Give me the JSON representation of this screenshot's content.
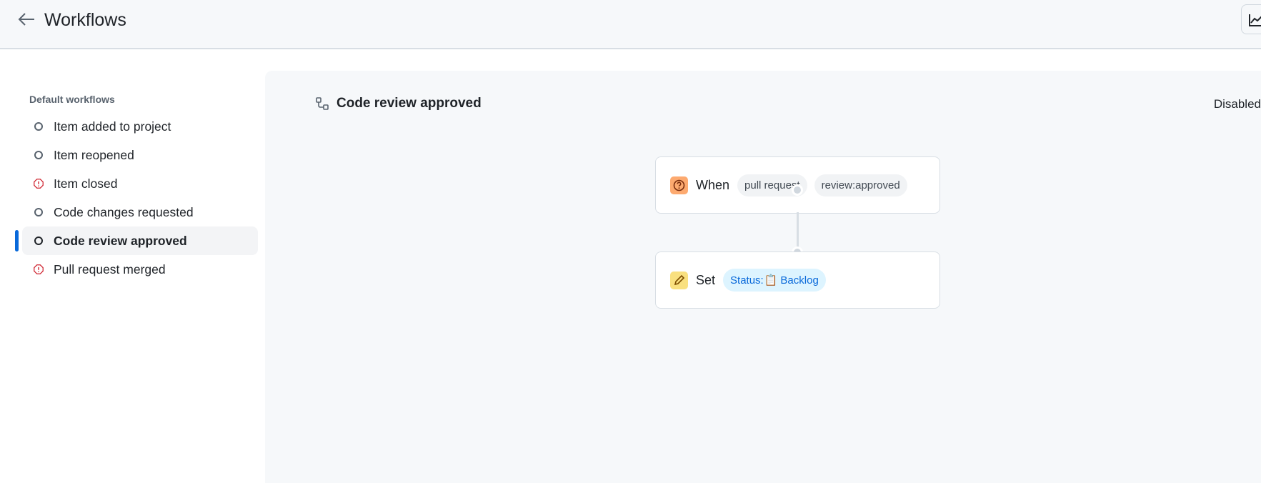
{
  "header": {
    "title": "Workflows",
    "back_icon": "arrow-left-icon",
    "insights_icon": "graph-icon"
  },
  "sidebar": {
    "heading": "Default workflows",
    "items": [
      {
        "label": "Item added to project",
        "status": "circle"
      },
      {
        "label": "Item reopened",
        "status": "circle"
      },
      {
        "label": "Item closed",
        "status": "alert"
      },
      {
        "label": "Code changes requested",
        "status": "circle"
      },
      {
        "label": "Code review approved",
        "status": "circle",
        "selected": true
      },
      {
        "label": "Pull request merged",
        "status": "alert"
      }
    ]
  },
  "panel": {
    "title": "Code review approved",
    "state": "Disabled",
    "trigger": {
      "keyword": "When",
      "chips": [
        "pull request",
        "review:approved"
      ]
    },
    "action": {
      "keyword": "Set",
      "field": "Status:",
      "value": "Backlog",
      "value_icon": "clipboard-icon"
    }
  },
  "colors": {
    "accent": "#0969da",
    "danger": "#cf222e",
    "trigger_badge": "#fdaa70",
    "action_badge": "#f9e07f"
  }
}
